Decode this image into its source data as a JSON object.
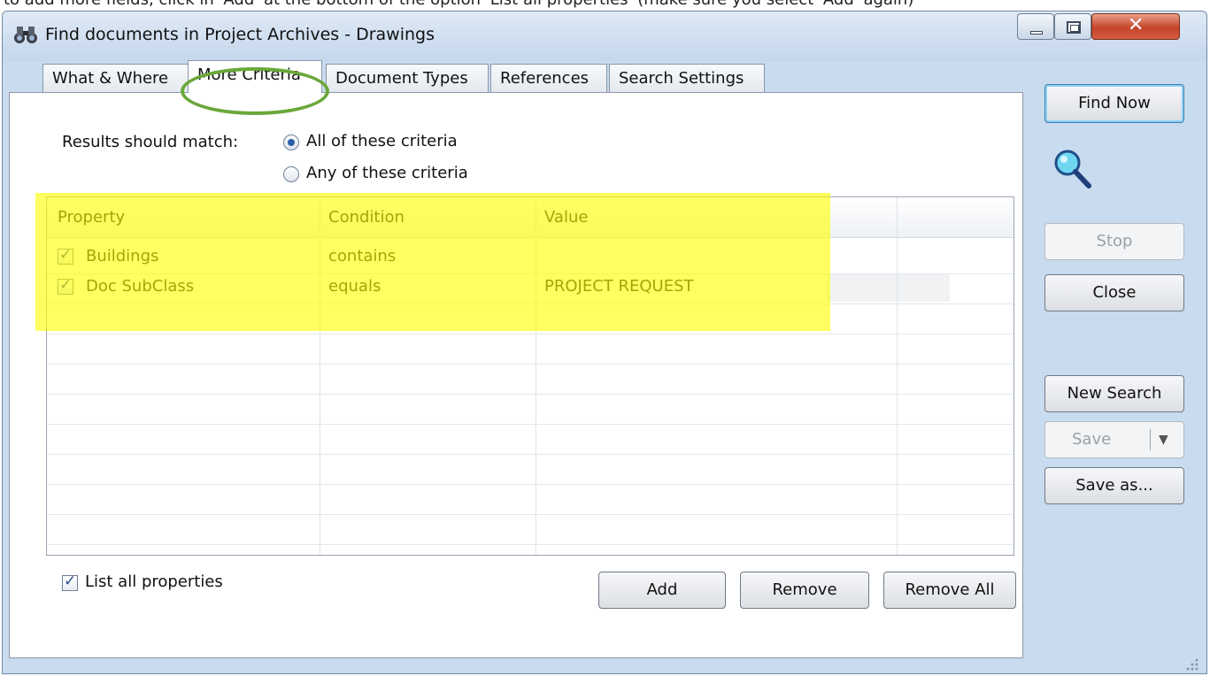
{
  "top_strip_text": "to add more fields, click in 'Add' at the bottom of the option 'List all properties' (make sure you select 'Add' again)",
  "window": {
    "title": "Find documents in Project Archives - Drawings"
  },
  "tabs": [
    {
      "label": "What & Where",
      "active": false
    },
    {
      "label": "More Criteria",
      "active": true
    },
    {
      "label": "Document Types",
      "active": false
    },
    {
      "label": "References",
      "active": false
    },
    {
      "label": "Search Settings",
      "active": false
    }
  ],
  "match": {
    "label": "Results should match:",
    "options": [
      {
        "label": "All of these criteria",
        "selected": true
      },
      {
        "label": "Any of these criteria",
        "selected": false
      }
    ]
  },
  "grid": {
    "columns": [
      "Property",
      "Condition",
      "Value"
    ],
    "rows": [
      {
        "checked": true,
        "property": "Buildings",
        "condition": "contains",
        "value": ""
      },
      {
        "checked": true,
        "property": "Doc SubClass",
        "condition": "equals",
        "value": "PROJECT REQUEST"
      }
    ]
  },
  "list_all": {
    "label": "List all properties",
    "checked": true
  },
  "buttons": {
    "add": "Add",
    "remove": "Remove",
    "remove_all": "Remove All",
    "find_now": "Find Now",
    "stop": "Stop",
    "close": "Close",
    "new_search": "New Search",
    "save": "Save",
    "save_as": "Save as..."
  },
  "colors": {
    "highlight": "#ffff00",
    "annotation_circle": "#6aa83a",
    "window_frame": "#c9dbee"
  }
}
